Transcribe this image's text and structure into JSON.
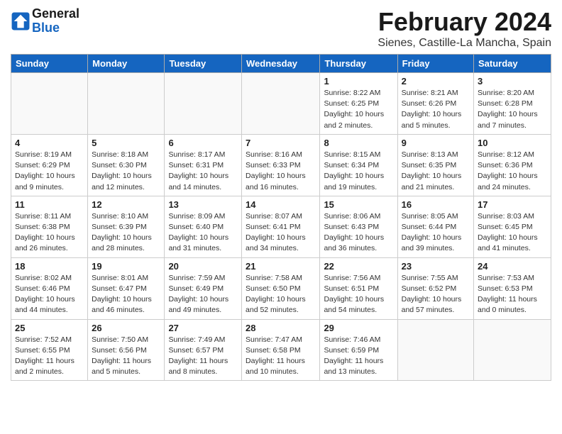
{
  "header": {
    "logo_line1": "General",
    "logo_line2": "Blue",
    "month_title": "February 2024",
    "location": "Sienes, Castille-La Mancha, Spain"
  },
  "days_of_week": [
    "Sunday",
    "Monday",
    "Tuesday",
    "Wednesday",
    "Thursday",
    "Friday",
    "Saturday"
  ],
  "weeks": [
    [
      {
        "day": "",
        "info": ""
      },
      {
        "day": "",
        "info": ""
      },
      {
        "day": "",
        "info": ""
      },
      {
        "day": "",
        "info": ""
      },
      {
        "day": "1",
        "info": "Sunrise: 8:22 AM\nSunset: 6:25 PM\nDaylight: 10 hours\nand 2 minutes."
      },
      {
        "day": "2",
        "info": "Sunrise: 8:21 AM\nSunset: 6:26 PM\nDaylight: 10 hours\nand 5 minutes."
      },
      {
        "day": "3",
        "info": "Sunrise: 8:20 AM\nSunset: 6:28 PM\nDaylight: 10 hours\nand 7 minutes."
      }
    ],
    [
      {
        "day": "4",
        "info": "Sunrise: 8:19 AM\nSunset: 6:29 PM\nDaylight: 10 hours\nand 9 minutes."
      },
      {
        "day": "5",
        "info": "Sunrise: 8:18 AM\nSunset: 6:30 PM\nDaylight: 10 hours\nand 12 minutes."
      },
      {
        "day": "6",
        "info": "Sunrise: 8:17 AM\nSunset: 6:31 PM\nDaylight: 10 hours\nand 14 minutes."
      },
      {
        "day": "7",
        "info": "Sunrise: 8:16 AM\nSunset: 6:33 PM\nDaylight: 10 hours\nand 16 minutes."
      },
      {
        "day": "8",
        "info": "Sunrise: 8:15 AM\nSunset: 6:34 PM\nDaylight: 10 hours\nand 19 minutes."
      },
      {
        "day": "9",
        "info": "Sunrise: 8:13 AM\nSunset: 6:35 PM\nDaylight: 10 hours\nand 21 minutes."
      },
      {
        "day": "10",
        "info": "Sunrise: 8:12 AM\nSunset: 6:36 PM\nDaylight: 10 hours\nand 24 minutes."
      }
    ],
    [
      {
        "day": "11",
        "info": "Sunrise: 8:11 AM\nSunset: 6:38 PM\nDaylight: 10 hours\nand 26 minutes."
      },
      {
        "day": "12",
        "info": "Sunrise: 8:10 AM\nSunset: 6:39 PM\nDaylight: 10 hours\nand 28 minutes."
      },
      {
        "day": "13",
        "info": "Sunrise: 8:09 AM\nSunset: 6:40 PM\nDaylight: 10 hours\nand 31 minutes."
      },
      {
        "day": "14",
        "info": "Sunrise: 8:07 AM\nSunset: 6:41 PM\nDaylight: 10 hours\nand 34 minutes."
      },
      {
        "day": "15",
        "info": "Sunrise: 8:06 AM\nSunset: 6:43 PM\nDaylight: 10 hours\nand 36 minutes."
      },
      {
        "day": "16",
        "info": "Sunrise: 8:05 AM\nSunset: 6:44 PM\nDaylight: 10 hours\nand 39 minutes."
      },
      {
        "day": "17",
        "info": "Sunrise: 8:03 AM\nSunset: 6:45 PM\nDaylight: 10 hours\nand 41 minutes."
      }
    ],
    [
      {
        "day": "18",
        "info": "Sunrise: 8:02 AM\nSunset: 6:46 PM\nDaylight: 10 hours\nand 44 minutes."
      },
      {
        "day": "19",
        "info": "Sunrise: 8:01 AM\nSunset: 6:47 PM\nDaylight: 10 hours\nand 46 minutes."
      },
      {
        "day": "20",
        "info": "Sunrise: 7:59 AM\nSunset: 6:49 PM\nDaylight: 10 hours\nand 49 minutes."
      },
      {
        "day": "21",
        "info": "Sunrise: 7:58 AM\nSunset: 6:50 PM\nDaylight: 10 hours\nand 52 minutes."
      },
      {
        "day": "22",
        "info": "Sunrise: 7:56 AM\nSunset: 6:51 PM\nDaylight: 10 hours\nand 54 minutes."
      },
      {
        "day": "23",
        "info": "Sunrise: 7:55 AM\nSunset: 6:52 PM\nDaylight: 10 hours\nand 57 minutes."
      },
      {
        "day": "24",
        "info": "Sunrise: 7:53 AM\nSunset: 6:53 PM\nDaylight: 11 hours\nand 0 minutes."
      }
    ],
    [
      {
        "day": "25",
        "info": "Sunrise: 7:52 AM\nSunset: 6:55 PM\nDaylight: 11 hours\nand 2 minutes."
      },
      {
        "day": "26",
        "info": "Sunrise: 7:50 AM\nSunset: 6:56 PM\nDaylight: 11 hours\nand 5 minutes."
      },
      {
        "day": "27",
        "info": "Sunrise: 7:49 AM\nSunset: 6:57 PM\nDaylight: 11 hours\nand 8 minutes."
      },
      {
        "day": "28",
        "info": "Sunrise: 7:47 AM\nSunset: 6:58 PM\nDaylight: 11 hours\nand 10 minutes."
      },
      {
        "day": "29",
        "info": "Sunrise: 7:46 AM\nSunset: 6:59 PM\nDaylight: 11 hours\nand 13 minutes."
      },
      {
        "day": "",
        "info": ""
      },
      {
        "day": "",
        "info": ""
      }
    ]
  ]
}
